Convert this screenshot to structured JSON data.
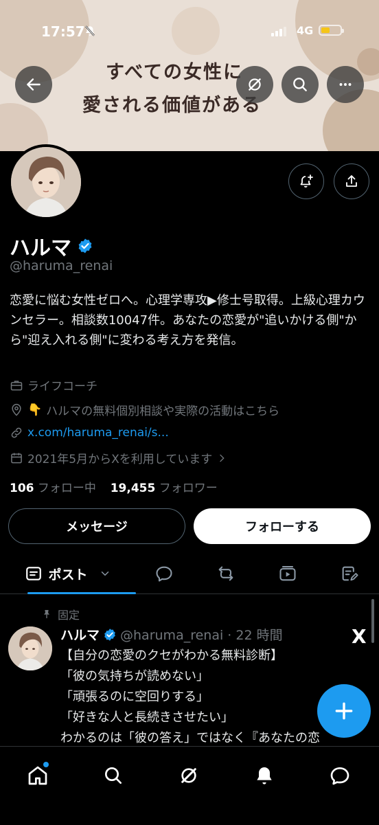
{
  "status_bar": {
    "time": "17:57",
    "network": "4G"
  },
  "banner": {
    "line1": "すべての女性に",
    "line2": "愛される価値がある"
  },
  "profile": {
    "name": "ハルマ",
    "handle": "@haruma_renai",
    "bio": "恋愛に悩む女性ゼロへ。心理学専攻▶修士号取得。上級心理カウンセラー。相談数10047件。あなたの恋愛が\"追いかける側\"から\"迎え入れる側\"に変わる考え方を発信。",
    "category": "ライフコーチ",
    "location_emoji": "👇",
    "location": "ハルマの無料個別相談や実際の活動はこちら",
    "link": "x.com/haruma_renai/s...",
    "joined": "2021年5月からXを利用しています",
    "following_count": "106",
    "following_label": "フォロー中",
    "followers_count": "19,455",
    "followers_label": "フォロワー"
  },
  "actions": {
    "message_label": "メッセージ",
    "follow_label": "フォローする"
  },
  "tabs": {
    "active_label": "ポスト"
  },
  "post": {
    "pinned_label": "固定",
    "author": "ハルマ",
    "meta": "@haruma_renai · 22 時間",
    "lines": [
      "【自分の恋愛のクセがわかる無料診断】",
      "「彼の気持ちが読めない」",
      "「頑張るのに空回りする」",
      "「好きな人と長続きさせたい」",
      "わかるのは「彼の答え」ではなく『あなたの恋"
    ]
  },
  "colors": {
    "accent": "#1d9bf0",
    "background": "#000000",
    "muted": "#71767b"
  },
  "icons": [
    "back-arrow-icon",
    "grok-icon",
    "search-icon",
    "more-icon",
    "bell-plus-icon",
    "share-icon",
    "verified-badge-icon",
    "briefcase-icon",
    "location-pin-icon",
    "link-icon",
    "calendar-icon",
    "chevron-right-icon",
    "posts-icon",
    "chevron-down-icon",
    "reply-icon",
    "repost-icon",
    "video-icon",
    "article-icon",
    "pin-icon",
    "x-logo-icon",
    "plus-icon",
    "home-icon",
    "grok-icon",
    "notification-bell-icon",
    "message-icon"
  ]
}
